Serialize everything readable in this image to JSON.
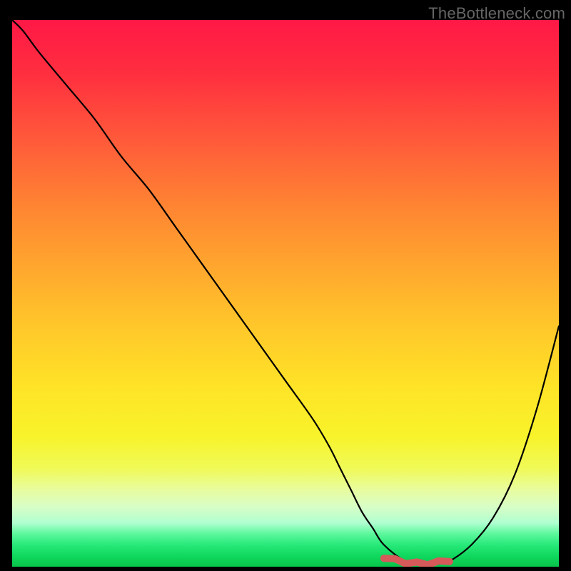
{
  "watermark": "TheBottleneck.com",
  "chart_data": {
    "type": "line",
    "title": "",
    "xlabel": "",
    "ylabel": "",
    "xlim": [
      0,
      100
    ],
    "ylim": [
      0,
      100
    ],
    "grid": false,
    "legend": false,
    "series": [
      {
        "name": "bottleneck-curve",
        "x": [
          0,
          2,
          5,
          10,
          15,
          20,
          25,
          30,
          35,
          40,
          45,
          50,
          55,
          58,
          60,
          62,
          64,
          66,
          68,
          72,
          76,
          78,
          80,
          84,
          88,
          92,
          96,
          100
        ],
        "values": [
          100,
          98,
          94,
          88,
          82,
          75,
          69,
          62,
          55,
          48,
          41,
          34,
          27,
          22,
          18,
          14,
          10,
          7,
          4,
          1,
          0.5,
          0.5,
          1,
          4,
          9,
          17,
          29,
          44
        ]
      }
    ],
    "highlight": {
      "name": "optimal-range",
      "x": [
        68,
        70,
        72,
        74,
        76,
        78,
        80
      ],
      "values": [
        1.8,
        1.2,
        0.8,
        0.6,
        0.6,
        0.8,
        1.2
      ],
      "color": "#d65a5a"
    },
    "gradient_stops": [
      {
        "pos": 0.0,
        "color": "#ff1846"
      },
      {
        "pos": 0.1,
        "color": "#ff2f3f"
      },
      {
        "pos": 0.22,
        "color": "#ff5a3a"
      },
      {
        "pos": 0.34,
        "color": "#ff8432"
      },
      {
        "pos": 0.45,
        "color": "#ffa62e"
      },
      {
        "pos": 0.56,
        "color": "#ffc72a"
      },
      {
        "pos": 0.67,
        "color": "#ffe327"
      },
      {
        "pos": 0.76,
        "color": "#f8f32a"
      },
      {
        "pos": 0.82,
        "color": "#f0fa57"
      },
      {
        "pos": 0.86,
        "color": "#e8fca0"
      },
      {
        "pos": 0.89,
        "color": "#d8fec6"
      },
      {
        "pos": 0.92,
        "color": "#b0ffd0"
      },
      {
        "pos": 0.94,
        "color": "#5cf79c"
      },
      {
        "pos": 0.96,
        "color": "#28e97a"
      },
      {
        "pos": 0.98,
        "color": "#10d85e"
      },
      {
        "pos": 1.0,
        "color": "#08c44a"
      }
    ]
  }
}
